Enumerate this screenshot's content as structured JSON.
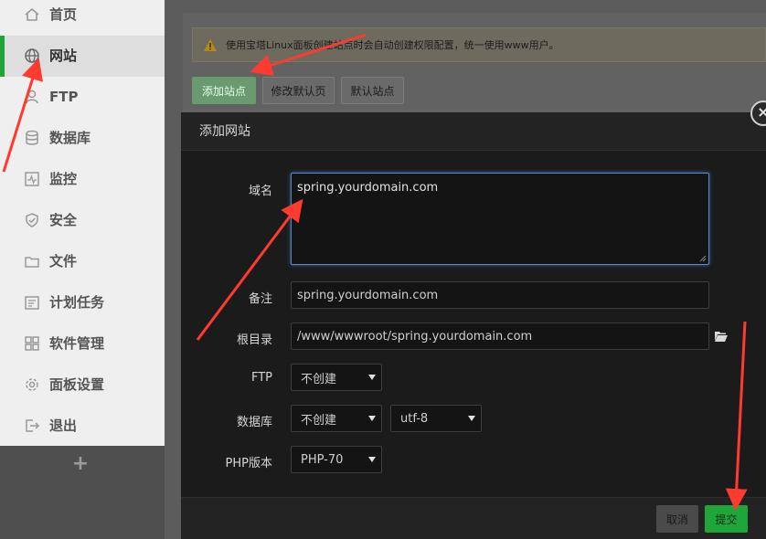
{
  "sidebar": {
    "items": [
      {
        "label": "首页",
        "icon": "home-icon"
      },
      {
        "label": "网站",
        "icon": "globe-icon",
        "active": true
      },
      {
        "label": "FTP",
        "icon": "user-icon"
      },
      {
        "label": "数据库",
        "icon": "database-icon"
      },
      {
        "label": "监控",
        "icon": "monitor-icon"
      },
      {
        "label": "安全",
        "icon": "shield-icon"
      },
      {
        "label": "文件",
        "icon": "folder-icon"
      },
      {
        "label": "计划任务",
        "icon": "clock-icon"
      },
      {
        "label": "软件管理",
        "icon": "grid-icon"
      },
      {
        "label": "面板设置",
        "icon": "gear-icon"
      },
      {
        "label": "退出",
        "icon": "logout-icon"
      }
    ],
    "add_label": "+"
  },
  "notice": {
    "text": "使用宝塔Linux面板创建站点时会自动创建权限配置，统一使用www用户。",
    "icon": "warning-icon"
  },
  "toolbar": {
    "add_site": "添加站点",
    "edit_default_page": "修改默认页",
    "default_site": "默认站点"
  },
  "modal": {
    "title": "添加网站",
    "close": "×",
    "fields": {
      "domain_label": "域名",
      "domain_value": "spring.yourdomain.com",
      "remark_label": "备注",
      "remark_value": "spring.yourdomain.com",
      "root_label": "根目录",
      "root_value": "/www/wwwroot/spring.yourdomain.com",
      "ftp_label": "FTP",
      "ftp_value": "不创建",
      "db_label": "数据库",
      "db_value": "不创建",
      "db_charset": "utf-8",
      "php_label": "PHP版本",
      "php_value": "PHP-70"
    },
    "cancel": "取消",
    "submit": "提交"
  },
  "colors": {
    "accent": "#20a53a",
    "arrow": "#ff3b30"
  }
}
